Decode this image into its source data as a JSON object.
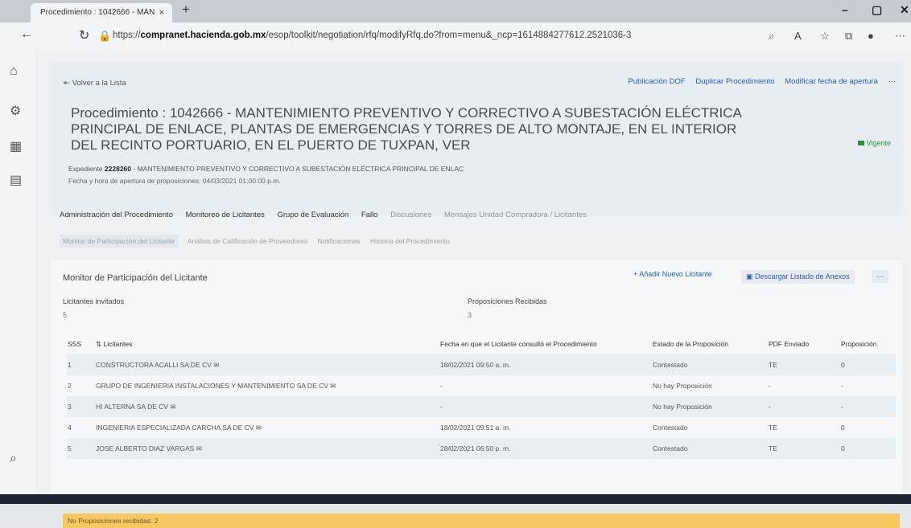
{
  "browser": {
    "tab_title": "Procedimiento : 1042666 - MAN",
    "tab_close": "×",
    "new_tab": "+",
    "url_prefix": "https://",
    "url_host": "compranet.hacienda.gob.mx",
    "url_path": "/esop/toolkit/negotiation/rfq/modifyRfq.do?from=menu&_ncp=1614884277612.2521036-3"
  },
  "header": {
    "back_label": "Volver a la Lista",
    "actions": [
      "Publicación DOF",
      "Duplicar Procedimiento",
      "Modificar fecha de apertura",
      "···"
    ],
    "title": "Procedimiento : 1042666 - MANTENIMIENTO PREVENTIVO Y CORRECTIVO A SUBESTACIÓN ELÉCTRICA PRINCIPAL DE ENLACE, PLANTAS DE EMERGENCIAS Y TORRES DE ALTO MONTAJE, EN EL INTERIOR DEL RECINTO PORTUARIO, EN EL PUERTO DE TUXPAN, VER",
    "status": "Vigente",
    "expediente_label": "Expediente",
    "expediente_num": "2228260",
    "expediente_desc": "- MANTENIMIENTO PREVENTIVO Y CORRECTIVO A SUBESTACIÓN ELÉCTRICA PRINCIPAL DE ENLAC",
    "fecha": "Fecha y hora de apertura de proposiciones: 04/03/2021 01:00:00 p.m."
  },
  "tabs_main": [
    "Administración del Procedimiento",
    "Monitoreo de Licitantes",
    "Grupo de Evaluación",
    "Fallo",
    "Discusiones",
    "Mensajes Unidad Compradora / Licitantes"
  ],
  "tabs_sub": [
    "Monitor de Participación del Licitante",
    "Análisis de Calificación de Proveedores",
    "Notificaciones",
    "Historia del Procedimiento"
  ],
  "panel": {
    "title": "Monitor de Participación del Licitante",
    "add_label": "+ Añadir Nuevo Licitante",
    "download_label": "Descargar Listado de Anexos",
    "more_label": "···",
    "invited_label": "Licitantes invitados",
    "invited_value": "5",
    "received_label": "Proposiciones Recibidas",
    "received_value": "3"
  },
  "table": {
    "headers": [
      "SSS",
      "Licitantes",
      "Fecha en que el Licitante consultó el Procedimiento",
      "Estado de la Proposición",
      "PDF Enviado",
      "Proposición"
    ],
    "rows": [
      [
        "1",
        "CONSTRUCTORA ACALLI SA DE CV",
        "18/02/2021 09:50 a. m.",
        "Contestado",
        "TE",
        "0"
      ],
      [
        "2",
        "GRUPO DE INGENIERIA INSTALACIONES Y MANTENIMIENTO SA DE CV",
        "-",
        "No hay Proposición",
        "-",
        "-"
      ],
      [
        "3",
        "HI ALTERNA SA DE CV",
        "-",
        "No hay Proposición",
        "-",
        "-"
      ],
      [
        "4",
        "INGENIERIA ESPECIALIZADA CARCHA SA DE CV",
        "18/02/2021 09:51 a. m.",
        "Contestado",
        "TE",
        "0"
      ],
      [
        "5",
        "JOSE ALBERTO DIAZ VARGAS",
        "28/02/2021 06:50 p. m.",
        "Contestado",
        "TE",
        "0"
      ]
    ]
  },
  "footer_note": "No Proposiciones recibidas: 2",
  "colors": {
    "accent": "#2a5caa",
    "status_green": "#2d8f3c",
    "warning": "#f7c85f"
  }
}
